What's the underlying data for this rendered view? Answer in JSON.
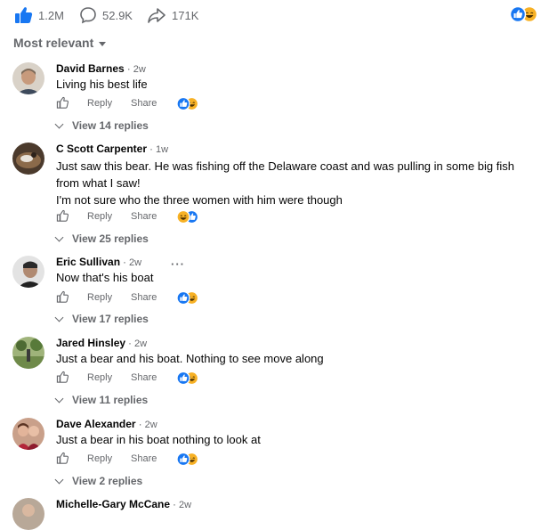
{
  "stats": {
    "likes": "1.2M",
    "comments": "52.9K",
    "shares": "171K"
  },
  "sort": {
    "label": "Most relevant"
  },
  "actions": {
    "reply": "Reply",
    "share": "Share"
  },
  "colors": {
    "like_blue": "#1877f2",
    "haha_yellow": "#f7b125",
    "muted": "#65676b"
  },
  "comments": [
    {
      "name": "David Barnes",
      "time": "2w",
      "lines": [
        "Living his best life"
      ],
      "replies": "View 14 replies",
      "reactions": [
        "like-icon",
        "haha-icon"
      ]
    },
    {
      "name": "C Scott Carpenter",
      "time": "1w",
      "lines": [
        "Just saw this bear. He was fishing off the Delaware coast and was pulling in some big fish",
        "from what I saw!",
        "I'm not sure who the three women with him were though"
      ],
      "replies": "View 25 replies",
      "reactions": [
        "haha-icon",
        "like-icon"
      ]
    },
    {
      "name": "Eric Sullivan",
      "time": "2w",
      "lines": [
        "Now that's his boat"
      ],
      "replies": "View 17 replies",
      "reactions": [
        "like-icon",
        "haha-icon"
      ]
    },
    {
      "name": "Jared Hinsley",
      "time": "2w",
      "lines": [
        "Just a bear and his boat. Nothing to see move along"
      ],
      "replies": "View 11 replies",
      "reactions": [
        "like-icon",
        "haha-icon"
      ]
    },
    {
      "name": "Dave Alexander",
      "time": "2w",
      "lines": [
        "Just a bear in his boat nothing to look at"
      ],
      "replies": "View 2 replies",
      "reactions": [
        "like-icon",
        "haha-icon"
      ]
    },
    {
      "name": "Michelle-Gary McCane",
      "time": "2w"
    }
  ]
}
